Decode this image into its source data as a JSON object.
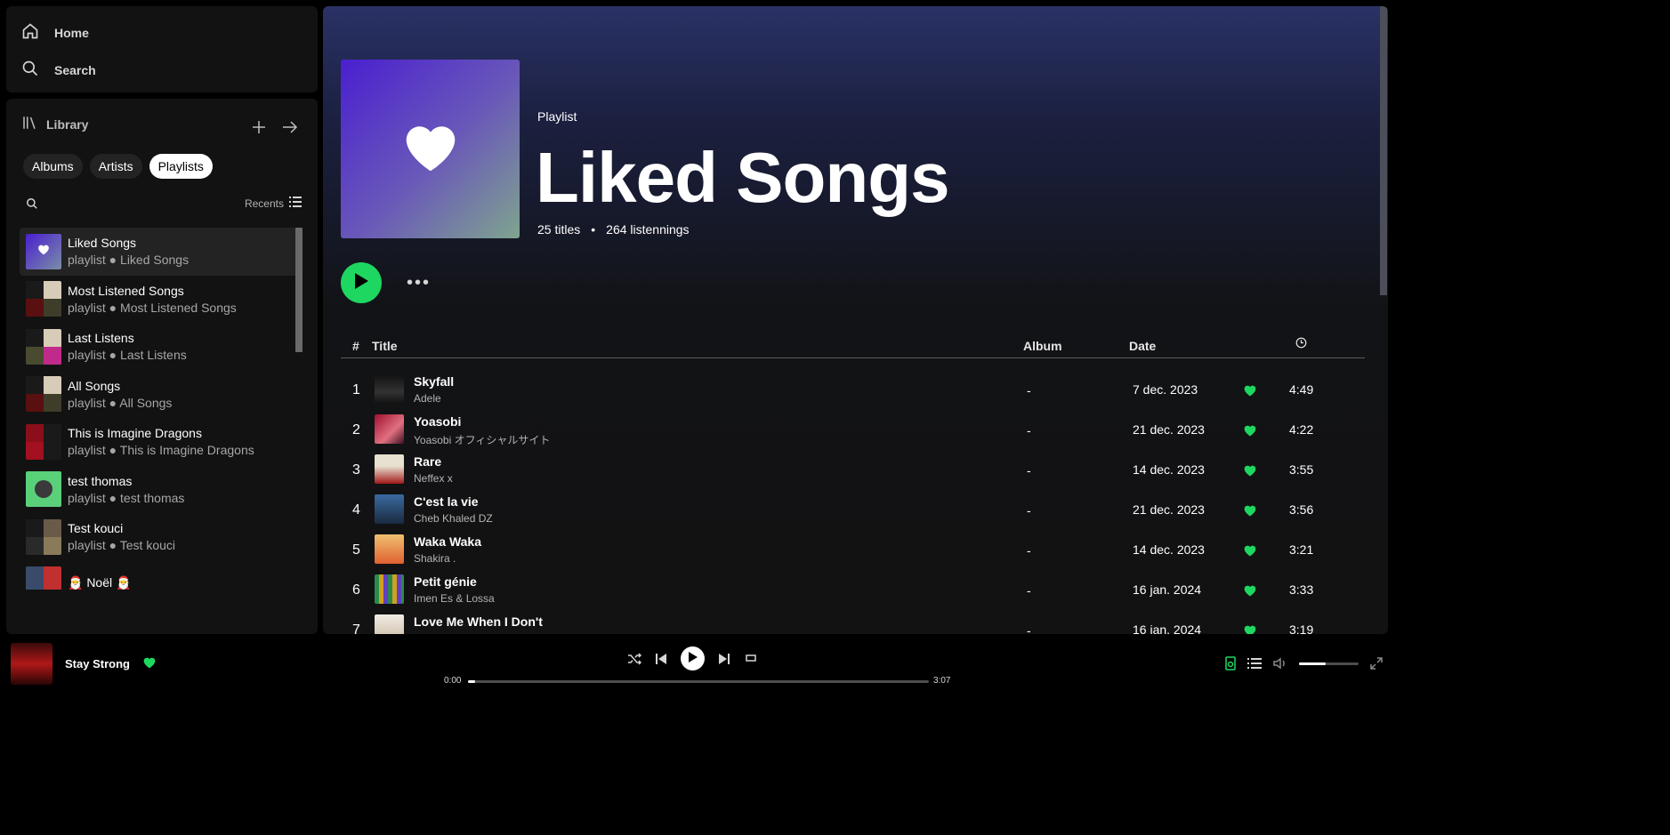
{
  "nav": {
    "home": "Home",
    "search": "Search"
  },
  "library": {
    "title": "Library",
    "chips": [
      "Albums",
      "Artists",
      "Playlists"
    ],
    "active_chip": "Playlists",
    "sort": "Recents",
    "items": [
      {
        "name": "Liked Songs",
        "sub": "playlist ● Liked Songs"
      },
      {
        "name": "Most Listened Songs",
        "sub": "playlist ● Most Listened Songs"
      },
      {
        "name": "Last Listens",
        "sub": "playlist ● Last Listens"
      },
      {
        "name": "All Songs",
        "sub": "playlist ● All Songs"
      },
      {
        "name": "This is Imagine Dragons",
        "sub": "playlist ● This is Imagine Dragons"
      },
      {
        "name": "test thomas",
        "sub": "playlist ● test thomas"
      },
      {
        "name": "Test kouci",
        "sub": "playlist ● Test kouci"
      },
      {
        "name": "🎅 Noël 🎅",
        "sub": ""
      }
    ]
  },
  "playlist": {
    "type_label": "Playlist",
    "title": "Liked Songs",
    "titles_count": "25 titles",
    "separator": "•",
    "listens": "264 listennings"
  },
  "table": {
    "headers": {
      "num": "#",
      "title": "Title",
      "album": "Album",
      "date": "Date"
    },
    "rows": [
      {
        "num": "1",
        "title": "Skyfall",
        "artist": "Adele",
        "album": "-",
        "date": "7 dec. 2023",
        "duration": "4:49"
      },
      {
        "num": "2",
        "title": "Yoasobi",
        "artist": "Yoasobi オフィシャルサイト",
        "album": "-",
        "date": "21 dec. 2023",
        "duration": "4:22"
      },
      {
        "num": "3",
        "title": "Rare",
        "artist": "Neffex x",
        "album": "-",
        "date": "14 dec. 2023",
        "duration": "3:55"
      },
      {
        "num": "4",
        "title": "C'est la vie",
        "artist": "Cheb Khaled DZ",
        "album": "-",
        "date": "21 dec. 2023",
        "duration": "3:56"
      },
      {
        "num": "5",
        "title": "Waka Waka",
        "artist": "Shakira .",
        "album": "-",
        "date": "14 dec. 2023",
        "duration": "3:21"
      },
      {
        "num": "6",
        "title": "Petit génie",
        "artist": "Imen Es & Lossa",
        "album": "-",
        "date": "16 jan. 2024",
        "duration": "3:33"
      },
      {
        "num": "7",
        "title": "Love Me When I Don't",
        "artist": "",
        "album": "-",
        "date": "16 jan. 2024",
        "duration": "3:19"
      }
    ]
  },
  "player": {
    "track": "Stay Strong",
    "current_time": "0:00",
    "total_time": "3:07",
    "progress_fraction": 0.015,
    "volume_fraction": 0.45
  },
  "colors": {
    "accent": "#1ed760",
    "background": "#121212"
  }
}
